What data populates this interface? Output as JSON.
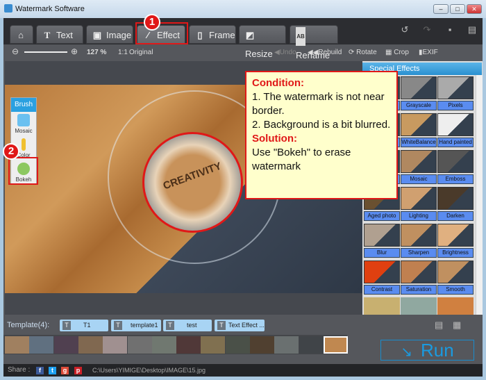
{
  "window": {
    "title": "Watermark Software"
  },
  "tabs": [
    {
      "label": "",
      "icon": "home-icon"
    },
    {
      "label": "Text",
      "icon": "T"
    },
    {
      "label": "Image",
      "icon": "image-icon"
    },
    {
      "label": "Effect",
      "icon": "wand-icon"
    },
    {
      "label": "Frame",
      "icon": "frame-icon"
    },
    {
      "label": "Resize",
      "icon": "resize-icon"
    },
    {
      "label": "Rename",
      "icon": "AB"
    }
  ],
  "badges": {
    "one": "1",
    "two": "2"
  },
  "toolbar": {
    "zoom": "127 %",
    "original_icon": "1:1",
    "original": "Original",
    "undo": "Undo",
    "rebuild": "Rebuild",
    "rotate": "Rotate",
    "crop": "Crop",
    "exif": "EXIF"
  },
  "brush": {
    "title": "Brush",
    "items": [
      "Mosaic",
      "Color",
      "Bokeh"
    ]
  },
  "photo": {
    "cup_text": "CREATIVITY"
  },
  "callout": {
    "condition_title": "Condition:",
    "line1": "1. The watermark is not near border.",
    "line2": "2. Background is a bit blurred.",
    "solution_title": "Solution:",
    "solution": "Use \"Bokeh\" to erase watermark"
  },
  "effects": {
    "title": "Special Effects",
    "items": [
      "",
      "Grayscale",
      "Pixels",
      "",
      "WhiteBalance",
      "Hand painted",
      "",
      "Mosaic",
      "Emboss",
      "Aged photo",
      "Lighting",
      "Darken",
      "Blur",
      "Sharpen",
      "Brightness",
      "Contrast",
      "Saturation",
      "Smooth"
    ]
  },
  "templates": {
    "label": "Template(4):",
    "items": [
      "T1",
      "template1",
      "test",
      "Text Effect ..."
    ]
  },
  "run": "Run",
  "share": {
    "label": "Share :",
    "path": "C:\\Users\\YIMIGE\\Desktop\\IMAGE\\15.jpg"
  }
}
